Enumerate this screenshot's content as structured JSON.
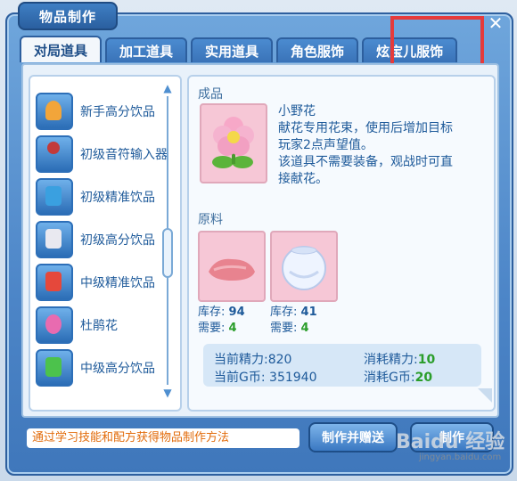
{
  "window": {
    "title": "物品制作",
    "close_glyph": "✕"
  },
  "tabs": [
    "对局道具",
    "加工道具",
    "实用道具",
    "角色服饰",
    "炫宝儿服饰"
  ],
  "list": {
    "items": [
      {
        "label": "新手高分饮品",
        "icon": "bottle-icon",
        "color": "#f2a53a"
      },
      {
        "label": "初级音符输入器",
        "icon": "joystick-icon",
        "color": "#c23a3a"
      },
      {
        "label": "初级精准饮品",
        "icon": "can-icon",
        "color": "#3aa0e0"
      },
      {
        "label": "初级高分饮品",
        "icon": "can-icon",
        "color": "#e9e9f0"
      },
      {
        "label": "中级精准饮品",
        "icon": "can-icon",
        "color": "#e5483b"
      },
      {
        "label": "杜鹃花",
        "icon": "flower-icon",
        "color": "#e86bb0"
      },
      {
        "label": "中级高分饮品",
        "icon": "can-icon",
        "color": "#4cc24c"
      }
    ]
  },
  "detail": {
    "product_label": "成品",
    "product_name": "小野花",
    "product_desc_1": "献花专用花束，使用后增加目标",
    "product_desc_2": "玩家2点声望值。",
    "product_desc_3": "该道具不需要装备，观战时可直",
    "product_desc_4": "接献花。",
    "materials_label": "原料",
    "materials": [
      {
        "stock_label": "库存:",
        "stock": "94",
        "need_label": "需要:",
        "need": "4"
      },
      {
        "stock_label": "库存:",
        "stock": "41",
        "need_label": "需要:",
        "need": "4"
      }
    ],
    "energy_current_label": "当前精力:",
    "energy_current": "820",
    "coin_current_label": "当前G币:",
    "coin_current": "351940",
    "energy_cost_label": "消耗精力:",
    "energy_cost": "10",
    "coin_cost_label": "消耗G币:",
    "coin_cost": "20"
  },
  "footer": {
    "hint": "通过学习技能和配方获得物品制作方法",
    "gift_button": "制作并赠送",
    "make_button": "制作"
  },
  "watermark": {
    "text": "Baidu 经验",
    "sub": "jingyan.baidu.com"
  }
}
